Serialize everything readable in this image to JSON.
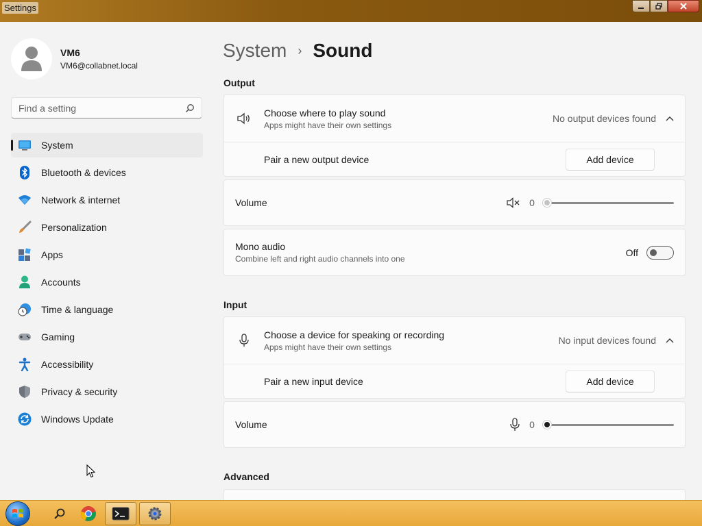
{
  "window": {
    "title": "Settings",
    "controls": {
      "minimize": "—",
      "maximize": "❐",
      "close": "X"
    }
  },
  "profile": {
    "name": "VM6",
    "email": "VM6@collabnet.local"
  },
  "search": {
    "placeholder": "Find a setting",
    "icon": "search-icon"
  },
  "sidebar": {
    "items": [
      {
        "label": "System",
        "icon": "system-icon",
        "active": true
      },
      {
        "label": "Bluetooth & devices",
        "icon": "bluetooth-icon"
      },
      {
        "label": "Network & internet",
        "icon": "wifi-icon"
      },
      {
        "label": "Personalization",
        "icon": "brush-icon"
      },
      {
        "label": "Apps",
        "icon": "apps-icon"
      },
      {
        "label": "Accounts",
        "icon": "account-icon"
      },
      {
        "label": "Time & language",
        "icon": "clock-globe-icon"
      },
      {
        "label": "Gaming",
        "icon": "gamepad-icon"
      },
      {
        "label": "Accessibility",
        "icon": "accessibility-icon"
      },
      {
        "label": "Privacy & security",
        "icon": "shield-icon"
      },
      {
        "label": "Windows Update",
        "icon": "update-icon"
      }
    ]
  },
  "breadcrumb": {
    "parent": "System",
    "separator": "›",
    "current": "Sound"
  },
  "output": {
    "section_title": "Output",
    "choose": {
      "title": "Choose where to play sound",
      "subtitle": "Apps might have their own settings",
      "status": "No output devices found",
      "icon": "speaker-icon"
    },
    "pair": {
      "label": "Pair a new output device",
      "button": "Add device"
    },
    "volume": {
      "label": "Volume",
      "value": "0",
      "level": 0,
      "icon": "speaker-muted-icon"
    },
    "mono": {
      "title": "Mono audio",
      "subtitle": "Combine left and right audio channels into one",
      "state": "Off",
      "on": false
    }
  },
  "input": {
    "section_title": "Input",
    "choose": {
      "title": "Choose a device for speaking or recording",
      "subtitle": "Apps might have their own settings",
      "status": "No input devices found",
      "icon": "microphone-icon"
    },
    "pair": {
      "label": "Pair a new input device",
      "button": "Add device"
    },
    "volume": {
      "label": "Volume",
      "value": "0",
      "level": 0,
      "icon": "microphone-icon"
    }
  },
  "advanced": {
    "section_title": "Advanced"
  },
  "taskbar": {
    "items": [
      "start-orb-icon",
      "search-icon",
      "chrome-icon",
      "terminal-icon",
      "settings-gear-icon"
    ]
  }
}
